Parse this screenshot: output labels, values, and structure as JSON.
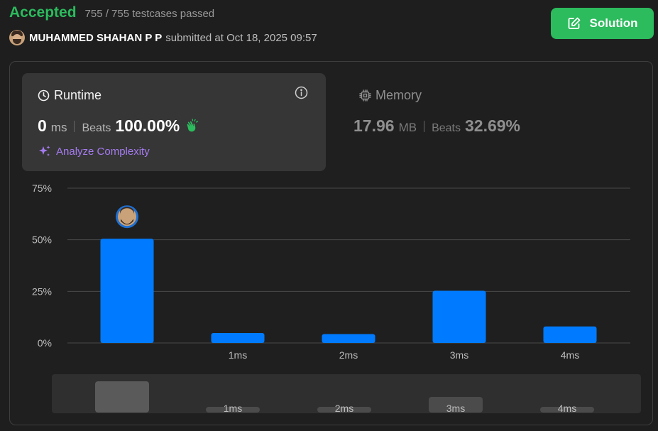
{
  "status": {
    "title": "Accepted",
    "testcases": "755 / 755 testcases passed"
  },
  "submitter": {
    "name": "MUHAMMED SHAHAN P P",
    "submitted": "submitted at Oct 18, 2025 09:57"
  },
  "solution_button": {
    "label": "Solution"
  },
  "runtime": {
    "title": "Runtime",
    "value": "0",
    "unit": "ms",
    "beats_label": "Beats",
    "beats": "100.00%",
    "analyze_label": "Analyze Complexity"
  },
  "memory": {
    "title": "Memory",
    "value": "17.96",
    "unit": "MB",
    "beats_label": "Beats",
    "beats": "32.69%"
  },
  "colors": {
    "accent_green": "#2cbb5d",
    "bar_blue": "#007bff",
    "analyze_purple": "#a57bf0"
  },
  "chart_data": {
    "type": "bar",
    "categories": [
      "0ms",
      "1ms",
      "2ms",
      "3ms",
      "4ms"
    ],
    "tick_labels": [
      "",
      "1ms",
      "2ms",
      "3ms",
      "4ms"
    ],
    "values": [
      50.5,
      4.8,
      4.3,
      25.3,
      8.0
    ],
    "ylim": [
      0,
      75
    ],
    "yticks": [
      0,
      25,
      50,
      75
    ],
    "ytick_labels": [
      "0%",
      "25%",
      "50%",
      "75%"
    ],
    "highlight_index": 0,
    "grid": true,
    "minimap_tick_labels": [
      "",
      "1ms",
      "2ms",
      "3ms",
      "4ms"
    ]
  }
}
